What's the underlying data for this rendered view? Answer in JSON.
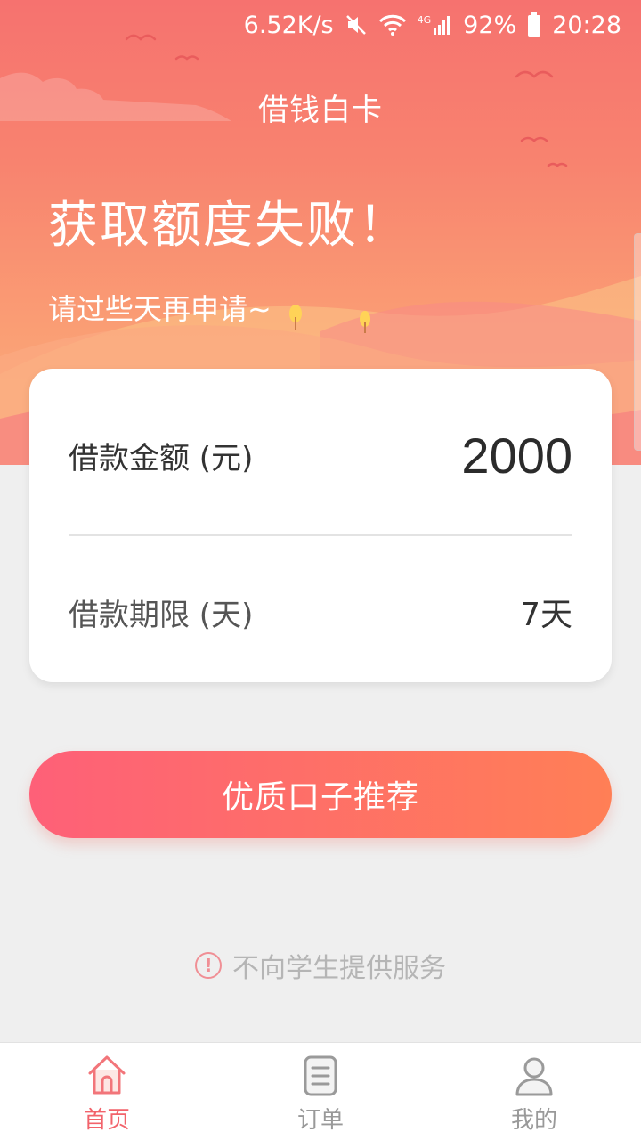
{
  "status_bar": {
    "speed": "6.52K/s",
    "network": "4G",
    "battery": "92%",
    "time": "20:28",
    "icons": [
      "mute-icon",
      "wifi-icon",
      "signal-icon",
      "battery-icon"
    ]
  },
  "header": {
    "app_title": "借钱白卡",
    "headline": "获取额度失败！",
    "subline": "请过些天再申请~"
  },
  "card": {
    "amount_label": "借款金额 (元)",
    "amount_value": "2000",
    "term_label": "借款期限 (天)",
    "term_value": "7天"
  },
  "cta": {
    "label": "优质口子推荐"
  },
  "notice": {
    "icon": "info-icon",
    "text": "不向学生提供服务"
  },
  "tabbar": {
    "items": [
      {
        "label": "首页",
        "icon": "home-icon",
        "active": true
      },
      {
        "label": "订单",
        "icon": "order-list-icon",
        "active": false
      },
      {
        "label": "我的",
        "icon": "profile-icon",
        "active": false
      }
    ]
  },
  "colors": {
    "accent": "#f2636b",
    "button_start": "#fe6078",
    "button_end": "#ff7f56",
    "header_top": "#f6726f",
    "header_bottom": "#fbb37d"
  }
}
